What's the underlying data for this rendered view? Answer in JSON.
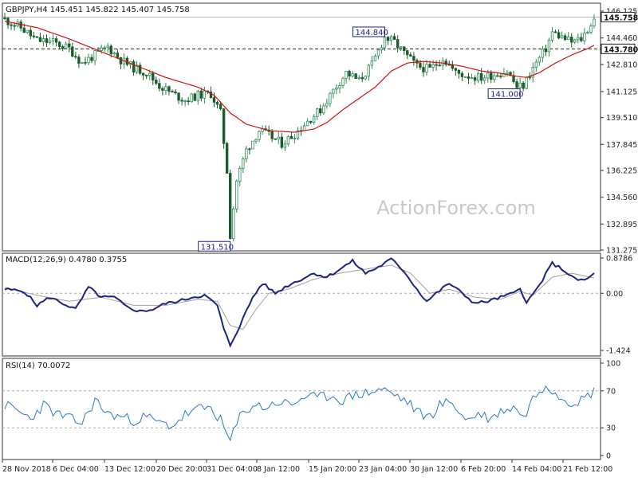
{
  "chart_data": [
    {
      "type": "candlestick",
      "title": "GBPJPY,H4  145.451 145.822 145.407 145.758",
      "y_ticks": [
        "146.125",
        "144.460",
        "142.810",
        "141.125",
        "139.510",
        "137.845",
        "136.225",
        "134.560",
        "132.895",
        "131.275"
      ],
      "ylim": [
        131.275,
        146.125
      ],
      "current_price": {
        "value": 145.758,
        "label": "145.758"
      },
      "horizontal_line": {
        "value": 143.78,
        "label": "143.780",
        "style": "dashed"
      },
      "annotations": [
        {
          "label": "144.840",
          "value": 144.84,
          "x_index": 118
        },
        {
          "label": "141.000",
          "value": 141.0,
          "x_index": 160
        },
        {
          "label": "131.510",
          "value": 131.51,
          "x_index": 70
        }
      ],
      "watermark": "ActionForex.com",
      "series": [
        {
          "name": "Price",
          "anchors": [
            [
              0,
              145.6
            ],
            [
              5,
              145.1
            ],
            [
              10,
              144.3
            ],
            [
              15,
              144.2
            ],
            [
              20,
              143.8
            ],
            [
              24,
              142.9
            ],
            [
              28,
              143.4
            ],
            [
              32,
              143.9
            ],
            [
              36,
              143.1
            ],
            [
              40,
              142.6
            ],
            [
              44,
              142.3
            ],
            [
              48,
              141.5
            ],
            [
              52,
              141.0
            ],
            [
              56,
              140.6
            ],
            [
              60,
              140.9
            ],
            [
              64,
              141.0
            ],
            [
              67,
              139.8
            ],
            [
              69,
              136.2
            ],
            [
              70,
              132.2
            ],
            [
              72,
              135.6
            ],
            [
              75,
              137.5
            ],
            [
              79,
              138.7
            ],
            [
              82,
              138.4
            ],
            [
              86,
              137.9
            ],
            [
              90,
              138.5
            ],
            [
              94,
              139.3
            ],
            [
              98,
              140.0
            ],
            [
              102,
              141.2
            ],
            [
              106,
              142.3
            ],
            [
              110,
              141.8
            ],
            [
              114,
              142.8
            ],
            [
              118,
              144.5
            ],
            [
              121,
              144.2
            ],
            [
              124,
              143.5
            ],
            [
              128,
              142.7
            ],
            [
              132,
              142.5
            ],
            [
              136,
              143.2
            ],
            [
              140,
              142.3
            ],
            [
              144,
              142.1
            ],
            [
              148,
              142.0
            ],
            [
              152,
              142.2
            ],
            [
              156,
              142.4
            ],
            [
              159,
              141.4
            ],
            [
              161,
              141.5
            ],
            [
              164,
              142.6
            ],
            [
              168,
              143.8
            ],
            [
              170,
              144.8
            ],
            [
              173,
              144.5
            ],
            [
              176,
              144.2
            ],
            [
              179,
              144.4
            ],
            [
              181,
              145.0
            ],
            [
              183,
              145.6
            ]
          ]
        },
        {
          "name": "MA",
          "anchors": [
            [
              0,
              145.5
            ],
            [
              10,
              145.1
            ],
            [
              20,
              144.4
            ],
            [
              30,
              143.6
            ],
            [
              40,
              142.8
            ],
            [
              50,
              142.0
            ],
            [
              60,
              141.4
            ],
            [
              65,
              140.9
            ],
            [
              70,
              139.8
            ],
            [
              75,
              139.1
            ],
            [
              82,
              138.7
            ],
            [
              90,
              138.6
            ],
            [
              96,
              138.8
            ],
            [
              100,
              139.2
            ],
            [
              105,
              140.0
            ],
            [
              110,
              140.7
            ],
            [
              115,
              141.4
            ],
            [
              120,
              142.4
            ],
            [
              125,
              142.9
            ],
            [
              130,
              143.0
            ],
            [
              136,
              142.9
            ],
            [
              142,
              142.7
            ],
            [
              148,
              142.4
            ],
            [
              153,
              142.3
            ],
            [
              158,
              142.1
            ],
            [
              162,
              142.0
            ],
            [
              166,
              142.3
            ],
            [
              171,
              142.9
            ],
            [
              176,
              143.4
            ],
            [
              181,
              143.8
            ],
            [
              183,
              144.0
            ]
          ]
        }
      ]
    },
    {
      "type": "line",
      "title": "MACD(12,26,9) 0.4780 0.3755",
      "y_ticks": [
        "0.8786",
        "0.00",
        "-1.424"
      ],
      "ylim": [
        -1.424,
        0.8786
      ],
      "series": [
        {
          "name": "MACD",
          "anchors": [
            [
              0,
              0.1
            ],
            [
              6,
              0.05
            ],
            [
              10,
              -0.3
            ],
            [
              14,
              -0.1
            ],
            [
              18,
              -0.25
            ],
            [
              22,
              -0.4
            ],
            [
              26,
              0.15
            ],
            [
              30,
              -0.1
            ],
            [
              34,
              -0.1
            ],
            [
              38,
              -0.35
            ],
            [
              42,
              -0.45
            ],
            [
              46,
              -0.4
            ],
            [
              50,
              -0.25
            ],
            [
              54,
              -0.2
            ],
            [
              58,
              -0.1
            ],
            [
              62,
              -0.05
            ],
            [
              66,
              -0.3
            ],
            [
              68,
              -0.9
            ],
            [
              70,
              -1.3
            ],
            [
              73,
              -0.8
            ],
            [
              77,
              -0.1
            ],
            [
              80,
              0.25
            ],
            [
              84,
              0.0
            ],
            [
              88,
              0.2
            ],
            [
              92,
              0.35
            ],
            [
              96,
              0.5
            ],
            [
              100,
              0.4
            ],
            [
              104,
              0.6
            ],
            [
              108,
              0.8
            ],
            [
              112,
              0.5
            ],
            [
              116,
              0.65
            ],
            [
              120,
              0.85
            ],
            [
              124,
              0.55
            ],
            [
              128,
              0.1
            ],
            [
              131,
              -0.2
            ],
            [
              134,
              0.0
            ],
            [
              138,
              0.25
            ],
            [
              142,
              0.0
            ],
            [
              146,
              -0.25
            ],
            [
              150,
              -0.2
            ],
            [
              154,
              -0.1
            ],
            [
              158,
              0.0
            ],
            [
              160,
              0.15
            ],
            [
              162,
              -0.25
            ],
            [
              166,
              0.2
            ],
            [
              170,
              0.75
            ],
            [
              174,
              0.55
            ],
            [
              177,
              0.35
            ],
            [
              180,
              0.32
            ],
            [
              183,
              0.48
            ]
          ]
        },
        {
          "name": "Signal",
          "anchors": [
            [
              0,
              0.15
            ],
            [
              10,
              -0.05
            ],
            [
              20,
              -0.2
            ],
            [
              30,
              -0.1
            ],
            [
              40,
              -0.3
            ],
            [
              50,
              -0.3
            ],
            [
              60,
              -0.15
            ],
            [
              66,
              -0.2
            ],
            [
              70,
              -0.8
            ],
            [
              74,
              -0.9
            ],
            [
              78,
              -0.4
            ],
            [
              82,
              0.0
            ],
            [
              88,
              0.1
            ],
            [
              96,
              0.35
            ],
            [
              104,
              0.5
            ],
            [
              112,
              0.6
            ],
            [
              120,
              0.7
            ],
            [
              126,
              0.5
            ],
            [
              132,
              0.0
            ],
            [
              138,
              0.1
            ],
            [
              146,
              -0.1
            ],
            [
              154,
              -0.15
            ],
            [
              160,
              0.05
            ],
            [
              164,
              -0.05
            ],
            [
              170,
              0.4
            ],
            [
              176,
              0.5
            ],
            [
              183,
              0.38
            ]
          ]
        }
      ]
    },
    {
      "type": "line",
      "title": "RSI(14) 70.0072",
      "y_ticks": [
        "100",
        "70",
        "30",
        "0"
      ],
      "ylim": [
        0,
        100
      ],
      "levels": [
        70,
        30
      ],
      "series": [
        {
          "name": "RSI",
          "anchors": [
            [
              0,
              55
            ],
            [
              4,
              48
            ],
            [
              8,
              40
            ],
            [
              12,
              55
            ],
            [
              16,
              45
            ],
            [
              20,
              40
            ],
            [
              24,
              35
            ],
            [
              28,
              60
            ],
            [
              32,
              45
            ],
            [
              36,
              42
            ],
            [
              40,
              38
            ],
            [
              44,
              42
            ],
            [
              48,
              35
            ],
            [
              52,
              32
            ],
            [
              56,
              44
            ],
            [
              60,
              50
            ],
            [
              64,
              52
            ],
            [
              67,
              38
            ],
            [
              70,
              15
            ],
            [
              73,
              42
            ],
            [
              77,
              55
            ],
            [
              81,
              52
            ],
            [
              85,
              58
            ],
            [
              89,
              55
            ],
            [
              93,
              64
            ],
            [
              97,
              62
            ],
            [
              101,
              65
            ],
            [
              105,
              60
            ],
            [
              109,
              66
            ],
            [
              113,
              68
            ],
            [
              117,
              72
            ],
            [
              121,
              66
            ],
            [
              125,
              58
            ],
            [
              129,
              45
            ],
            [
              132,
              42
            ],
            [
              135,
              55
            ],
            [
              139,
              58
            ],
            [
              143,
              38
            ],
            [
              147,
              45
            ],
            [
              151,
              40
            ],
            [
              155,
              50
            ],
            [
              159,
              52
            ],
            [
              161,
              40
            ],
            [
              164,
              62
            ],
            [
              168,
              78
            ],
            [
              172,
              65
            ],
            [
              176,
              58
            ],
            [
              179,
              60
            ],
            [
              183,
              70
            ]
          ]
        }
      ]
    }
  ],
  "x_axis": {
    "labels": [
      "28 Nov 2018",
      "6 Dec 04:00",
      "13 Dec 12:00",
      "20 Dec 20:00",
      "31 Dec 04:00",
      "8 Jan 12:00",
      "15 Jan 20:00",
      "23 Jan 04:00",
      "30 Jan 12:00",
      "6 Feb 20:00",
      "14 Feb 04:00",
      "21 Feb 12:00"
    ]
  },
  "colors": {
    "bull": "#2e8b57",
    "bear": "#1a5c2a",
    "ma": "#d01010",
    "macd": "#1a237e",
    "signal": "#a0a0a0",
    "rsi": "#2979c9",
    "grid": "#aaaaaa",
    "axis": "#333333",
    "label_box": "#1a237e",
    "watermark": "#c8c8c8"
  }
}
